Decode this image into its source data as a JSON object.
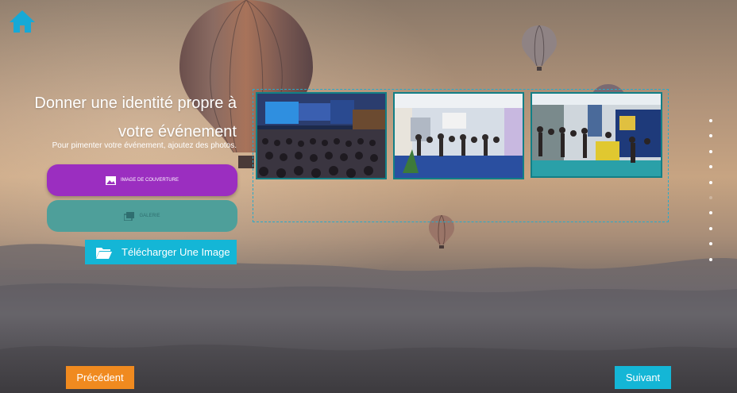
{
  "header": {
    "home_icon": "home-icon"
  },
  "panel": {
    "title": "Donner une identité propre à votre événement",
    "subtitle": "Pour pimenter votre événement, ajoutez des photos.",
    "cover_button_label": "IMAGE DE COUVERTURE",
    "gallery_button_label": "GALERIE",
    "upload_button_label": "Télécharger Une Image"
  },
  "gallery": {
    "images": [
      {
        "subject": "conference-auditorium"
      },
      {
        "subject": "exhibition-hall-crowd"
      },
      {
        "subject": "trade-show-booths"
      }
    ]
  },
  "steps": {
    "count": 10,
    "current": 6
  },
  "footer": {
    "previous_label": "Précédent",
    "next_label": "Suivant"
  },
  "colors": {
    "accent_purple": "#9b2ec0",
    "accent_teal": "#4e9f9a",
    "accent_cyan": "#14b6d6",
    "accent_orange": "#f08a1f",
    "home_icon": "#17a9d6"
  }
}
